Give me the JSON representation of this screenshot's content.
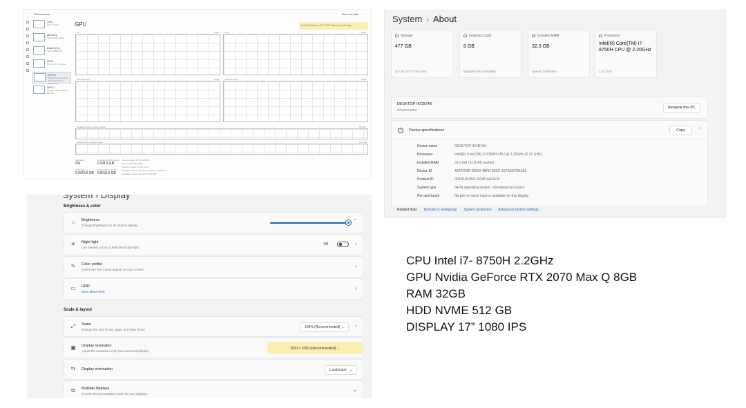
{
  "task_manager": {
    "title": "Performance",
    "run_task": "Run new task",
    "devices": [
      {
        "name": "CPU",
        "sub": "2%  2.71 GHz"
      },
      {
        "name": "Memory",
        "sub": "4.9/31.8 GB (15%)"
      },
      {
        "name": "Disk 0 (C:)",
        "sub": "SSD (NVMe)  0%"
      },
      {
        "name": "Wi-Fi",
        "sub": "Wi-Fi  S: 0  R: 0 Kbps"
      },
      {
        "name": "GPU 0",
        "sub": "NVIDIA GeForce RTX 2070 with Max-Q Design  0%"
      },
      {
        "name": "GPU 1",
        "sub": "Intel(R) UHD Graphics 630  0%"
      }
    ],
    "gpu_title": "GPU",
    "gpu_model": "NVIDIA GeForce RTX 2070 with Max-Q Design",
    "graph_labels": [
      "3D",
      "Copy",
      "Video Decode",
      "Video Encode",
      "Dedicated GPU memory usage",
      "Shared GPU memory usage"
    ],
    "graph_max": [
      "100%",
      "100%",
      "100%",
      "100%",
      "8.0 GB",
      "15.9 GB"
    ],
    "stats": [
      {
        "label": "Utilization",
        "value": "0%"
      },
      {
        "label": "Dedicated GPU memory",
        "value": "0.0/8.0 GB"
      },
      {
        "label": "GPU Memory",
        "value": "0.0/23.9 GB"
      },
      {
        "label": "Shared GPU memory",
        "value": "0.0/15.9 GB"
      }
    ],
    "details": [
      "Driver version: 27.21.14.5251",
      "Driver date: 9/11/2020",
      "DirectX version: 12 (FL 12.1)",
      "Physical location: PCI bus 1, device 0, function 0",
      "Hardware reserved memory: 165 MB"
    ]
  },
  "about": {
    "breadcrumb_parent": "System",
    "breadcrumb_current": "About",
    "cards": [
      {
        "label": "Storage",
        "value": "477 GB",
        "footer": "52 GB of 477 GB used"
      },
      {
        "label": "Graphics Card",
        "value": "8 GB",
        "footer": "Multiple GPUs installed"
      },
      {
        "label": "Installed RAM",
        "value": "32.0 GB",
        "footer": "Speed: 3200 MHz"
      },
      {
        "label": "Processor",
        "value": "Intel(R) Core(TM) i7-8750H CPU @ 2.20GHz",
        "footer": "2.21 GHz"
      }
    ],
    "device_name": "DESKTOP-IKCB7A6",
    "device_model": "POWERSPEC",
    "rename_button": "Rename this PC",
    "specs_title": "Device specifications",
    "copy_button": "Copy",
    "specs": [
      {
        "k": "Device name",
        "v": "DESKTOP-IKCB7A6"
      },
      {
        "k": "Processor",
        "v": "Intel(R) Core(TM) i7-8750H CPU @ 2.20GHz (2.21 GHz)"
      },
      {
        "k": "Installed RAM",
        "v": "32.0 GB (31.8 GB usable)"
      },
      {
        "k": "Device ID",
        "v": "40AF028F-DEE2-4BFE-8E5C-1576A5F0MA53"
      },
      {
        "k": "Product ID",
        "v": "00325-81550-18348-AAOEM"
      },
      {
        "k": "System type",
        "v": "64-bit operating system, x64-based processor"
      },
      {
        "k": "Pen and touch",
        "v": "No pen or touch input is available for this display"
      }
    ],
    "related_label": "Related links",
    "related_links": [
      "Domain or workgroup",
      "System protection",
      "Advanced system settings"
    ]
  },
  "display": {
    "breadcrumb": "System  ›  Display",
    "section_brightness": "Brightness & color",
    "section_scale": "Scale & layout",
    "brightness": {
      "title": "Brightness",
      "sub": "Change brightness for the built-in display",
      "level": 1.0
    },
    "night_light": {
      "title": "Night light",
      "sub": "Use warmer colors to help block blue light",
      "state": "Off"
    },
    "color_profile": {
      "title": "Color profile",
      "sub": "Determine how colors appear on your screen"
    },
    "hdr": {
      "title": "HDR",
      "link": "More about HDR"
    },
    "scale": {
      "title": "Scale",
      "sub": "Change the size of text, apps, and other items",
      "value": "100% (Recommended)"
    },
    "resolution": {
      "title": "Display resolution",
      "sub": "Adjust the resolution to fit your connected display",
      "value": "1920 × 1080 (Recommended)"
    },
    "orientation": {
      "title": "Display orientation",
      "value": "Landscape"
    },
    "multiple": {
      "title": "Multiple displays",
      "sub": "Choose the presentation mode for your displays"
    }
  },
  "specs_text": [
    "CPU Intel i7- 8750H 2.2GHz",
    "GPU Nvidia GeForce RTX 2070 Max Q 8GB",
    "RAM 32GB",
    "HDD NVME 512 GB",
    "DISPLAY 17” 1080 IPS"
  ]
}
